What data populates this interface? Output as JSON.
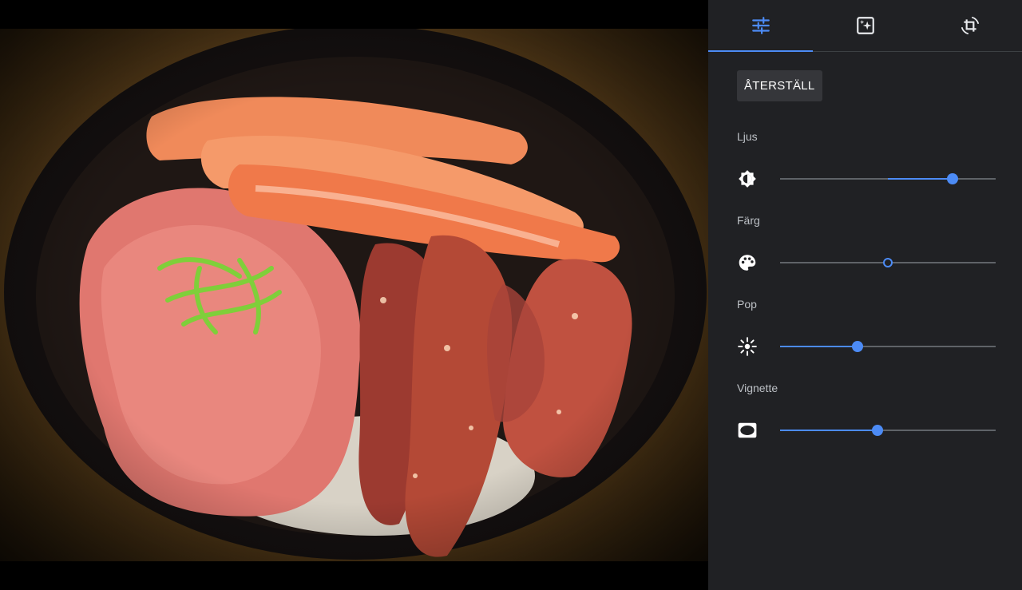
{
  "tabs": [
    {
      "name": "adjust",
      "icon": "tune-sliders-icon",
      "active": true
    },
    {
      "name": "filters",
      "icon": "auto-enhance-icon",
      "active": false
    },
    {
      "name": "crop",
      "icon": "crop-rotate-icon",
      "active": false
    }
  ],
  "reset_label": "ÅTERSTÄLL",
  "controls": [
    {
      "id": "light",
      "label": "Ljus",
      "icon": "brightness-icon",
      "value": 0.8,
      "center": 0.5,
      "mode": "centered"
    },
    {
      "id": "color",
      "label": "Färg",
      "icon": "palette-icon",
      "value": 0.5,
      "center": 0.5,
      "mode": "centered"
    },
    {
      "id": "pop",
      "label": "Pop",
      "icon": "pop-sparkle-icon",
      "value": 0.36,
      "mode": "from-start"
    },
    {
      "id": "vignette",
      "label": "Vignette",
      "icon": "vignette-icon",
      "value": 0.45,
      "mode": "from-start"
    }
  ],
  "colors": {
    "panel_bg": "#202124",
    "accent": "#4c8bf5",
    "track": "#5f6368",
    "button_bg": "#35363a"
  }
}
